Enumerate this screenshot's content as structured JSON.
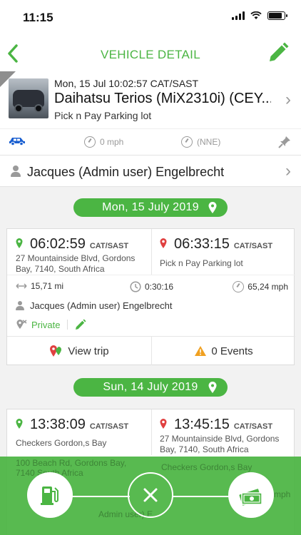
{
  "status_bar": {
    "time": "11:15"
  },
  "nav": {
    "title": "VEHICLE DETAIL",
    "back_icon": "chevron-left-icon",
    "edit_icon": "pencil-icon"
  },
  "vehicle": {
    "last_update": "Mon, 15 Jul 10:02:57 CAT/SAST",
    "name": "Daihatsu Terios (MiX2310i) (CEY...",
    "location": "Pick n Pay Parking lot",
    "speed": "0 mph",
    "heading": "(NNE)"
  },
  "driver": {
    "name": "Jacques (Admin user) Engelbrecht"
  },
  "days": [
    {
      "date_label": "Mon, 15 July 2019",
      "trip": {
        "start_time": "06:02:59",
        "start_tz": "CAT/SAST",
        "start_address": "27 Mountainside Blvd, Gordons Bay, 7140, South Africa",
        "end_time": "06:33:15",
        "end_tz": "CAT/SAST",
        "end_address": "Pick n Pay Parking lot",
        "distance": "15,71 mi",
        "duration": "0:30:16",
        "max_speed": "65,24 mph",
        "driver": "Jacques (Admin user) Engelbrecht",
        "privacy": "Private",
        "view_trip_label": "View trip",
        "events_label": "0 Events"
      }
    },
    {
      "date_label": "Sun, 14 July 2019",
      "trip": {
        "start_time": "13:38:09",
        "start_tz": "CAT/SAST",
        "start_address": "Checkers Gordon,s Bay",
        "end_time": "13:45:15",
        "end_tz": "CAT/SAST",
        "end_address": "27 Mountainside Blvd, Gordons Bay, 7140, South Africa",
        "driver": "Admin user) E"
      }
    }
  ],
  "overlay_ghost": {
    "start_address_partial": "100 Beach Rd, Gordons Bay, 7140 South Africa",
    "end_partial": "Checkers Gordon,s Bay",
    "speed_partial": "mph"
  },
  "colors": {
    "accent": "#4bb543",
    "alert": "#f0a020",
    "pin_end": "#e04040",
    "car_icon": "#1a5fd0"
  }
}
